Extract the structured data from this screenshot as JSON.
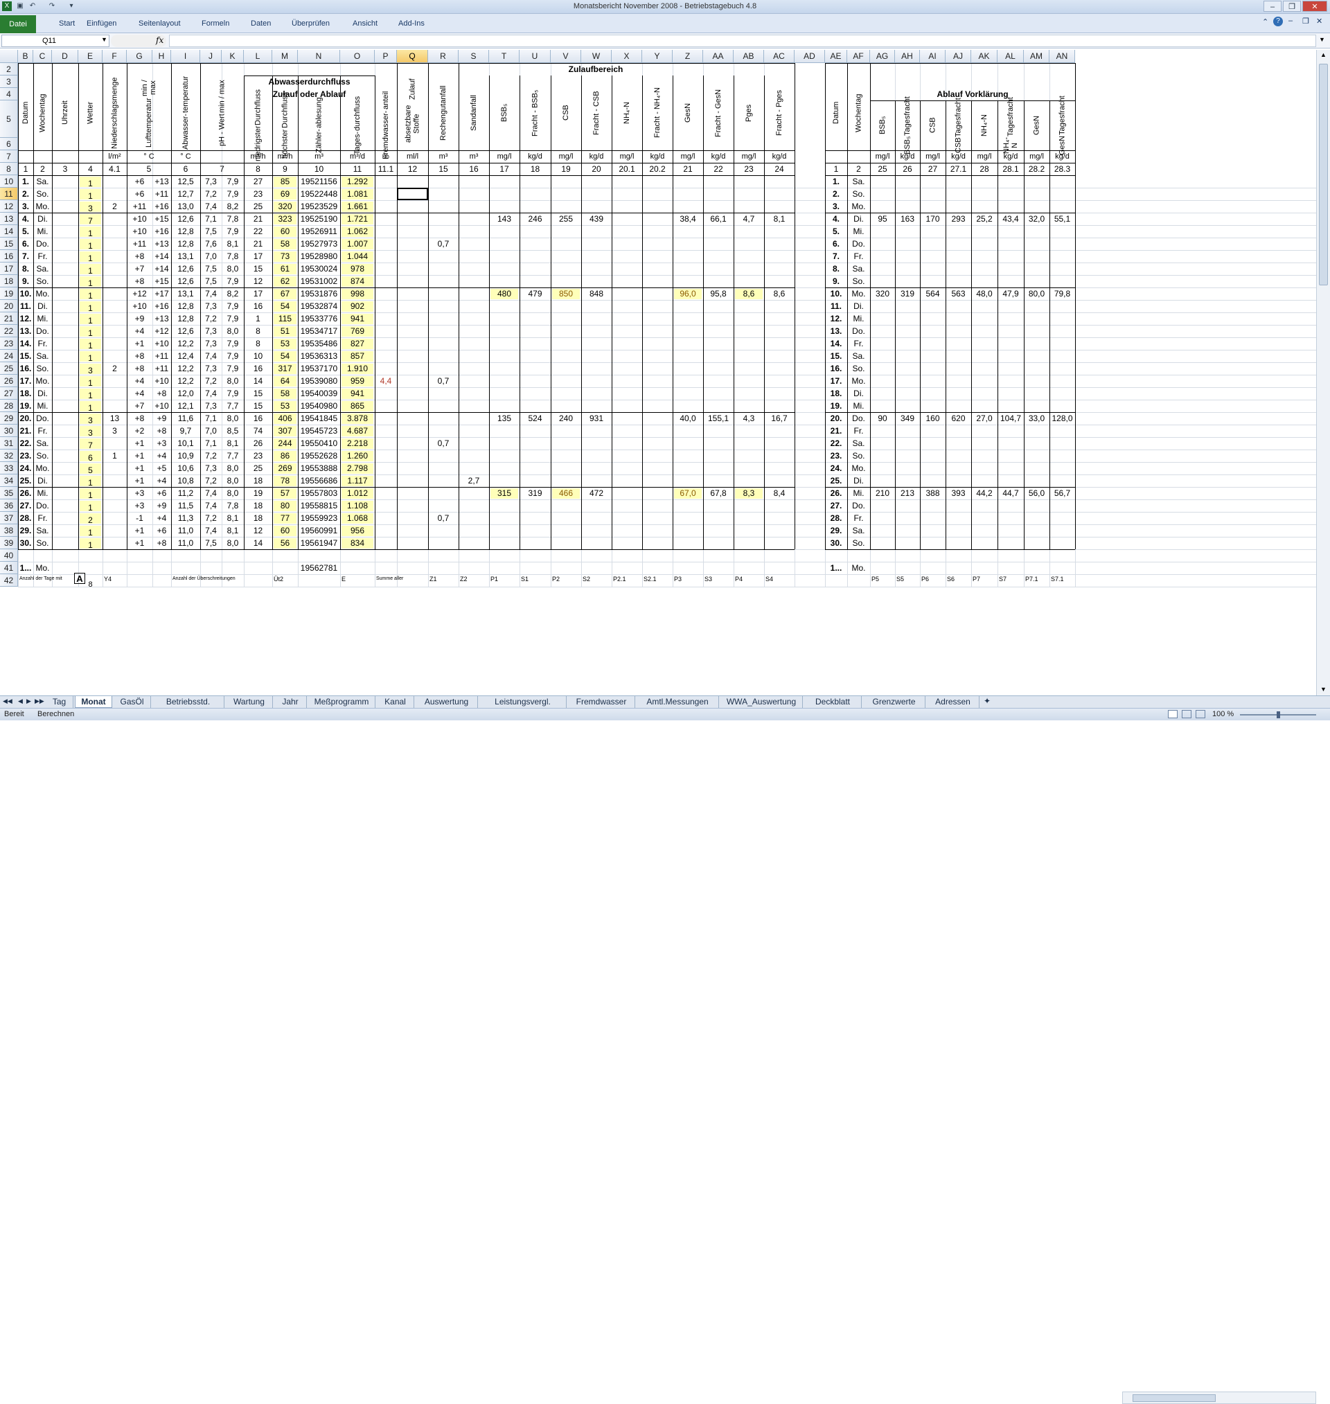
{
  "window": {
    "title": "Monatsbericht  November 2008  -  Betriebstagebuch 4.8"
  },
  "ribbon": {
    "file": "Datei",
    "tabs": [
      "Start",
      "Einfügen",
      "Seitenlayout",
      "Formeln",
      "Daten",
      "Überprüfen",
      "Ansicht",
      "Add-Ins"
    ]
  },
  "formula": {
    "namebox": "Q11",
    "fx": "fx",
    "value": ""
  },
  "columns": [
    "B",
    "C",
    "D",
    "E",
    "F",
    "G",
    "H",
    "I",
    "J",
    "K",
    "L",
    "M",
    "N",
    "O",
    "P",
    "Q",
    "R",
    "S",
    "T",
    "U",
    "V",
    "W",
    "X",
    "Y",
    "Z",
    "AA",
    "AB",
    "AC",
    "AD",
    "AE",
    "AF",
    "AG",
    "AH",
    "AI",
    "AJ",
    "AK",
    "AL",
    "AM",
    "AN"
  ],
  "selected_column": "Q",
  "selected_row": "11",
  "headers": {
    "zulaufbereich": "Zulaufbereich",
    "abwasser_line1": "Abwasserdurchfluss",
    "abwasser_line2": "Zulauf oder Ablauf",
    "ablauf": "Ablauf Vorklärung",
    "vertical": {
      "B": "Datum",
      "C": "Wochentag",
      "D": "Uhrzeit",
      "E": "Wetter",
      "F": "Niederschlagsmenge",
      "GH1": "Lufttemperatur",
      "GH2": "min / max",
      "I1": "Abwasser-",
      "I2": "temperatur",
      "JK1": "pH - Wert",
      "JK2": "min / max",
      "L1": "niedrigster",
      "L2": "Durchfluss",
      "M1": "höchster",
      "M2": "Durchfluss",
      "N1": "Zähler-",
      "N2": "ablesung",
      "O1": "Tages-",
      "O2": "durchfluss",
      "P1": "Fremdwasser-",
      "P2": "anteil",
      "Q1": "absetzbare Stoffe",
      "Q2": "Zulauf",
      "R": "Rechengutanfall",
      "S": "Sandanfall",
      "T": "BSB₅",
      "U": "Fracht - BSB₅",
      "V": "CSB",
      "W": "Fracht - CSB",
      "X": "NH₄-N",
      "Y": "Fracht - NH₄-N",
      "Z": "GesN",
      "AA": "Fracht - GesN",
      "AB": "Pges",
      "AC": "Fracht - Pges",
      "AE": "Datum",
      "AF": "Wochentag",
      "AG": "BSB₅",
      "AH1": "BSB₅",
      "AH2": "Tagesfracht",
      "AI": "CSB",
      "AJ1": "CSB",
      "AJ2": "Tagesfracht",
      "AK": "NH₄-N",
      "AL1": "NH₄-N",
      "AL2": "Tagesfracht",
      "AM": "GesN",
      "AN1": "GesN",
      "AN2": "Tagesfracht"
    },
    "units": {
      "F": "l/m²",
      "GH": "° C",
      "I": "° C",
      "L": "m³/h",
      "M": "m³/h",
      "N": "m³",
      "O": "m³/d",
      "P": "%",
      "Q": "ml/l",
      "R": "m³",
      "S": "m³",
      "T": "mg/l",
      "U": "kg/d",
      "V": "mg/l",
      "W": "kg/d",
      "X": "mg/l",
      "Y": "kg/d",
      "Z": "mg/l",
      "AA": "kg/d",
      "AB": "mg/l",
      "AC": "kg/d",
      "AG": "mg/l",
      "AH": "kg/d",
      "AI": "mg/l",
      "AJ": "kg/d",
      "AK": "mg/l",
      "AL": "kg/d",
      "AM": "mg/l",
      "AN": "kg/d"
    },
    "codes": {
      "B": "1",
      "C": "2",
      "D": "3",
      "E": "4",
      "F": "4.1",
      "GH": "5",
      "I": "6",
      "JK": "7",
      "L": "8",
      "M": "9",
      "N": "10",
      "O": "11",
      "P": "11.1",
      "Q": "12",
      "R": "15",
      "S": "16",
      "T": "17",
      "U": "18",
      "V": "19",
      "W": "20",
      "X": "20.1",
      "Y": "20.2",
      "Z": "21",
      "AA": "22",
      "AB": "23",
      "AC": "24",
      "AE": "1",
      "AF": "2",
      "AG": "25",
      "AH": "26",
      "AI": "27",
      "AJ": "27.1",
      "AK": "28",
      "AL": "28.1",
      "AM": "28.2",
      "AN": "28.3"
    }
  },
  "rows": [
    {
      "r": "10",
      "d": "1.",
      "w": "Sa.",
      "e": "1",
      "g": "+6",
      "h": "+13",
      "i": "12,5",
      "j": "7,3",
      "k": "7,9",
      "l": "27",
      "m": "85",
      "n": "19521156",
      "o": "1.292",
      "ae": "1.",
      "af": "Sa."
    },
    {
      "r": "11",
      "d": "2.",
      "w": "So.",
      "e": "1",
      "g": "+6",
      "h": "+11",
      "i": "12,7",
      "j": "7,2",
      "k": "7,9",
      "l": "23",
      "m": "69",
      "n": "19522448",
      "o": "1.081",
      "ae": "2.",
      "af": "So."
    },
    {
      "r": "12",
      "d": "3.",
      "w": "Mo.",
      "e": "3",
      "f": "2",
      "g": "+11",
      "h": "+16",
      "i": "13,0",
      "j": "7,4",
      "k": "8,2",
      "l": "25",
      "m": "320",
      "n": "19523529",
      "o": "1.661",
      "ae": "3.",
      "af": "Mo."
    },
    {
      "r": "13",
      "d": "4.",
      "w": "Di.",
      "e": "7",
      "g": "+10",
      "h": "+15",
      "i": "12,6",
      "j": "7,1",
      "k": "7,8",
      "l": "21",
      "m": "323",
      "n": "19525190",
      "o": "1.721",
      "t": "143",
      "u": "246",
      "v": "255",
      "ww": "439",
      "z": "38,4",
      "aa": "66,1",
      "ab": "4,7",
      "ac": "8,1",
      "ae": "4.",
      "af": "Di.",
      "ag": "95",
      "ah": "163",
      "ai": "170",
      "aj": "293",
      "ak": "25,2",
      "al": "43,4",
      "am": "32,0",
      "an": "55,1"
    },
    {
      "r": "14",
      "d": "5.",
      "w": "Mi.",
      "e": "1",
      "g": "+10",
      "h": "+16",
      "i": "12,8",
      "j": "7,5",
      "k": "7,9",
      "l": "22",
      "m": "60",
      "n": "19526911",
      "o": "1.062",
      "ae": "5.",
      "af": "Mi."
    },
    {
      "r": "15",
      "d": "6.",
      "w": "Do.",
      "e": "1",
      "g": "+11",
      "h": "+13",
      "i": "12,8",
      "j": "7,6",
      "k": "8,1",
      "l": "21",
      "m": "58",
      "n": "19527973",
      "o": "1.007",
      "rr": "0,7",
      "ae": "6.",
      "af": "Do."
    },
    {
      "r": "16",
      "d": "7.",
      "w": "Fr.",
      "e": "1",
      "g": "+8",
      "h": "+14",
      "i": "13,1",
      "j": "7,0",
      "k": "7,8",
      "l": "17",
      "m": "73",
      "n": "19528980",
      "o": "1.044",
      "ae": "7.",
      "af": "Fr."
    },
    {
      "r": "17",
      "d": "8.",
      "w": "Sa.",
      "e": "1",
      "g": "+7",
      "h": "+14",
      "i": "12,6",
      "j": "7,5",
      "k": "8,0",
      "l": "15",
      "m": "61",
      "n": "19530024",
      "o": "978",
      "ae": "8.",
      "af": "Sa."
    },
    {
      "r": "18",
      "d": "9.",
      "w": "So.",
      "e": "1",
      "g": "+8",
      "h": "+15",
      "i": "12,6",
      "j": "7,5",
      "k": "7,9",
      "l": "12",
      "m": "62",
      "n": "19531002",
      "o": "874",
      "ae": "9.",
      "af": "So."
    },
    {
      "r": "19",
      "d": "10.",
      "w": "Mo.",
      "e": "1",
      "g": "+12",
      "h": "+17",
      "i": "13,1",
      "j": "7,4",
      "k": "8,2",
      "l": "17",
      "m": "67",
      "n": "19531876",
      "o": "998",
      "t": "480",
      "u": "479",
      "v": "850",
      "ww": "848",
      "z": "96,0",
      "aa": "95,8",
      "ab": "8,6",
      "ac": "8,6",
      "ae": "10.",
      "af": "Mo.",
      "ag": "320",
      "ah": "319",
      "ai": "564",
      "aj": "563",
      "ak": "48,0",
      "al": "47,9",
      "am": "80,0",
      "an": "79,8"
    },
    {
      "r": "20",
      "d": "11.",
      "w": "Di.",
      "e": "1",
      "g": "+10",
      "h": "+16",
      "i": "12,8",
      "j": "7,3",
      "k": "7,9",
      "l": "16",
      "m": "54",
      "n": "19532874",
      "o": "902",
      "ae": "11.",
      "af": "Di."
    },
    {
      "r": "21",
      "d": "12.",
      "w": "Mi.",
      "e": "1",
      "g": "+9",
      "h": "+13",
      "i": "12,8",
      "j": "7,2",
      "k": "7,9",
      "l": "1",
      "m": "115",
      "n": "19533776",
      "o": "941",
      "ae": "12.",
      "af": "Mi."
    },
    {
      "r": "22",
      "d": "13.",
      "w": "Do.",
      "e": "1",
      "g": "+4",
      "h": "+12",
      "i": "12,6",
      "j": "7,3",
      "k": "8,0",
      "l": "8",
      "m": "51",
      "n": "19534717",
      "o": "769",
      "ae": "13.",
      "af": "Do."
    },
    {
      "r": "23",
      "d": "14.",
      "w": "Fr.",
      "e": "1",
      "g": "+1",
      "h": "+10",
      "i": "12,2",
      "j": "7,3",
      "k": "7,9",
      "l": "8",
      "m": "53",
      "n": "19535486",
      "o": "827",
      "ae": "14.",
      "af": "Fr."
    },
    {
      "r": "24",
      "d": "15.",
      "w": "Sa.",
      "e": "1",
      "g": "+8",
      "h": "+11",
      "i": "12,4",
      "j": "7,4",
      "k": "7,9",
      "l": "10",
      "m": "54",
      "n": "19536313",
      "o": "857",
      "ae": "15.",
      "af": "Sa."
    },
    {
      "r": "25",
      "d": "16.",
      "w": "So.",
      "e": "3",
      "f": "2",
      "g": "+8",
      "h": "+11",
      "i": "12,2",
      "j": "7,3",
      "k": "7,9",
      "l": "16",
      "m": "317",
      "n": "19537170",
      "o": "1.910",
      "ae": "16.",
      "af": "So."
    },
    {
      "r": "26",
      "d": "17.",
      "w": "Mo.",
      "e": "1",
      "g": "+4",
      "h": "+10",
      "i": "12,2",
      "j": "7,2",
      "k": "8,0",
      "l": "14",
      "m": "64",
      "n": "19539080",
      "o": "959",
      "p": "4,4",
      "rr": "0,7",
      "ae": "17.",
      "af": "Mo."
    },
    {
      "r": "27",
      "d": "18.",
      "w": "Di.",
      "e": "1",
      "g": "+4",
      "h": "+8",
      "i": "12,0",
      "j": "7,4",
      "k": "7,9",
      "l": "15",
      "m": "58",
      "n": "19540039",
      "o": "941",
      "ae": "18.",
      "af": "Di."
    },
    {
      "r": "28",
      "d": "19.",
      "w": "Mi.",
      "e": "1",
      "g": "+7",
      "h": "+10",
      "i": "12,1",
      "j": "7,3",
      "k": "7,7",
      "l": "15",
      "m": "53",
      "n": "19540980",
      "o": "865",
      "ae": "19.",
      "af": "Mi."
    },
    {
      "r": "29",
      "d": "20.",
      "w": "Do.",
      "e": "3",
      "f": "13",
      "g": "+8",
      "h": "+9",
      "i": "11,6",
      "j": "7,1",
      "k": "8,0",
      "l": "16",
      "m": "406",
      "n": "19541845",
      "o": "3.878",
      "t": "135",
      "u": "524",
      "v": "240",
      "ww": "931",
      "z": "40,0",
      "aa": "155,1",
      "ab": "4,3",
      "ac": "16,7",
      "ae": "20.",
      "af": "Do.",
      "ag": "90",
      "ah": "349",
      "ai": "160",
      "aj": "620",
      "ak": "27,0",
      "al": "104,7",
      "am": "33,0",
      "an": "128,0"
    },
    {
      "r": "30",
      "d": "21.",
      "w": "Fr.",
      "e": "3",
      "f": "3",
      "g": "+2",
      "h": "+8",
      "i": "9,7",
      "j": "7,0",
      "k": "8,5",
      "l": "74",
      "m": "307",
      "n": "19545723",
      "o": "4.687",
      "ae": "21.",
      "af": "Fr."
    },
    {
      "r": "31",
      "d": "22.",
      "w": "Sa.",
      "e": "7",
      "g": "+1",
      "h": "+3",
      "i": "10,1",
      "j": "7,1",
      "k": "8,1",
      "l": "26",
      "m": "244",
      "n": "19550410",
      "o": "2.218",
      "rr": "0,7",
      "ae": "22.",
      "af": "Sa."
    },
    {
      "r": "32",
      "d": "23.",
      "w": "So.",
      "e": "6",
      "f": "1",
      "g": "+1",
      "h": "+4",
      "i": "10,9",
      "j": "7,2",
      "k": "7,7",
      "l": "23",
      "m": "86",
      "n": "19552628",
      "o": "1.260",
      "ae": "23.",
      "af": "So."
    },
    {
      "r": "33",
      "d": "24.",
      "w": "Mo.",
      "e": "5",
      "g": "+1",
      "h": "+5",
      "i": "10,6",
      "j": "7,3",
      "k": "8,0",
      "l": "25",
      "m": "269",
      "n": "19553888",
      "o": "2.798",
      "ae": "24.",
      "af": "Mo."
    },
    {
      "r": "34",
      "d": "25.",
      "w": "Di.",
      "e": "1",
      "g": "+1",
      "h": "+4",
      "i": "10,8",
      "j": "7,2",
      "k": "8,0",
      "l": "18",
      "m": "78",
      "n": "19556686",
      "o": "1.117",
      "s": "2,7",
      "ae": "25.",
      "af": "Di."
    },
    {
      "r": "35",
      "d": "26.",
      "w": "Mi.",
      "e": "1",
      "g": "+3",
      "h": "+6",
      "i": "11,2",
      "j": "7,4",
      "k": "8,0",
      "l": "19",
      "m": "57",
      "n": "19557803",
      "o": "1.012",
      "t": "315",
      "u": "319",
      "v": "466",
      "ww": "472",
      "z": "67,0",
      "aa": "67,8",
      "ab": "8,3",
      "ac": "8,4",
      "ae": "26.",
      "af": "Mi.",
      "ag": "210",
      "ah": "213",
      "ai": "388",
      "aj": "393",
      "ak": "44,2",
      "al": "44,7",
      "am": "56,0",
      "an": "56,7"
    },
    {
      "r": "36",
      "d": "27.",
      "w": "Do.",
      "e": "1",
      "g": "+3",
      "h": "+9",
      "i": "11,5",
      "j": "7,4",
      "k": "7,8",
      "l": "18",
      "m": "80",
      "n": "19558815",
      "o": "1.108",
      "ae": "27.",
      "af": "Do."
    },
    {
      "r": "37",
      "d": "28.",
      "w": "Fr.",
      "e": "2",
      "g": "-1",
      "h": "+4",
      "i": "11,3",
      "j": "7,2",
      "k": "8,1",
      "l": "18",
      "m": "77",
      "n": "19559923",
      "o": "1.068",
      "rr": "0,7",
      "ae": "28.",
      "af": "Fr."
    },
    {
      "r": "38",
      "d": "29.",
      "w": "Sa.",
      "e": "1",
      "g": "+1",
      "h": "+6",
      "i": "11,0",
      "j": "7,4",
      "k": "8,1",
      "l": "12",
      "m": "60",
      "n": "19560991",
      "o": "956",
      "ae": "29.",
      "af": "Sa."
    },
    {
      "r": "39",
      "d": "30.",
      "w": "So.",
      "e": "1",
      "g": "+1",
      "h": "+8",
      "i": "11,0",
      "j": "7,5",
      "k": "8,0",
      "l": "14",
      "m": "56",
      "n": "19561947",
      "o": "834",
      "ae": "30.",
      "af": "So."
    },
    {
      "r": "40"
    },
    {
      "r": "41",
      "d": "1...",
      "w": "Mo.",
      "n": "19562781",
      "ae": "1...",
      "af": "Mo."
    }
  ],
  "row42": {
    "r": "Z1",
    "b": "Anzahl der Tage mit",
    "e": "A",
    "e2": "8",
    "f": "Y4",
    "i": "Anzahl der Überschreitungen",
    "m": "Üt2",
    "o": "E",
    "p": "Summe aller",
    "s": "Z2",
    "t": "P1",
    "u": "S1",
    "v": "P2",
    "w": "S2",
    "x": "P2.1",
    "y": "S2.1",
    "z": "P3",
    "aa": "S3",
    "ab": "P4",
    "ac": "S4",
    "ag": "P5",
    "ah": "S5",
    "ai": "P6",
    "aj": "S6",
    "ak": "P7",
    "al": "S7",
    "am": "P7.1",
    "an": "S7.1"
  },
  "sheets": [
    "Tag",
    "Monat",
    "GasÖl",
    "Betriebsstd.",
    "Wartung",
    "Jahr",
    "Meßprogramm",
    "Kanal",
    "Auswertung",
    "Leistungsvergl.",
    "Fremdwasser",
    "Amtl.Messungen",
    "WWA_Auswertung",
    "Deckblatt",
    "Grenzwerte",
    "Adressen"
  ],
  "active_sheet": "Monat",
  "status": {
    "left1": "Bereit",
    "left2": "Berechnen",
    "zoom": "100 %"
  }
}
